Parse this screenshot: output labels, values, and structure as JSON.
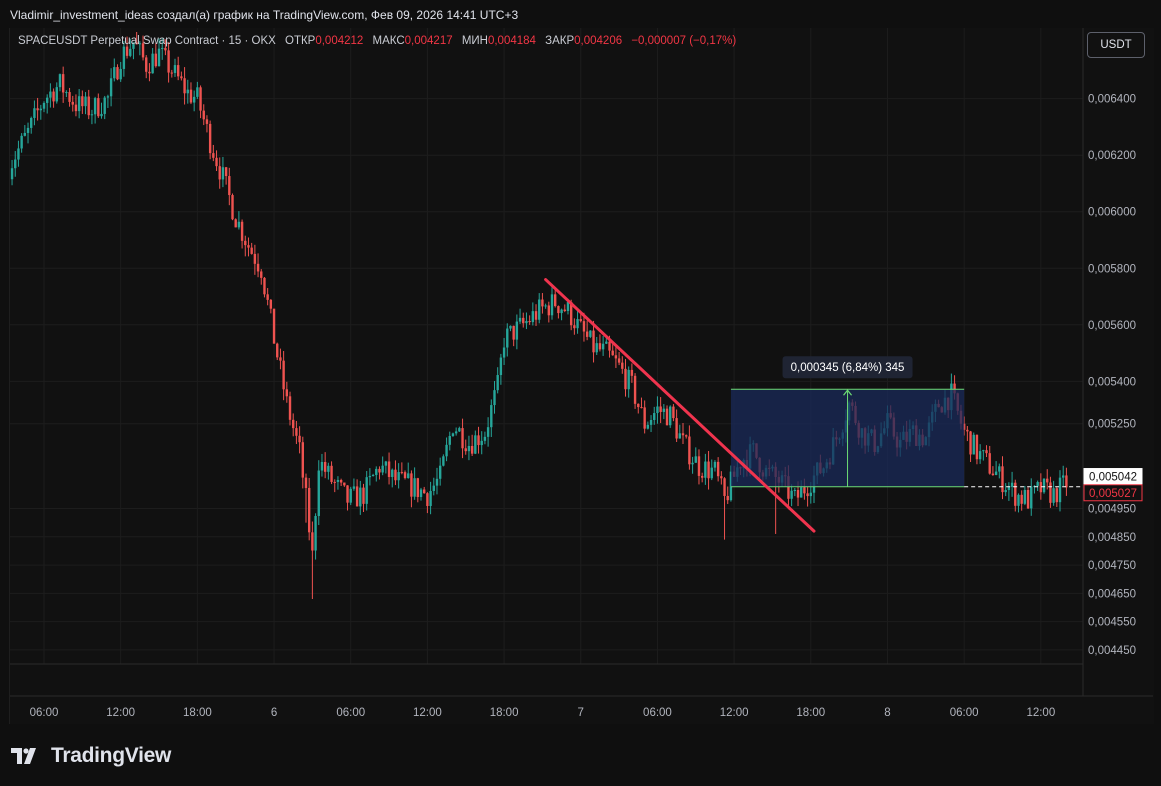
{
  "header": {
    "author_line": "Vladimir_investment_ideas создал(а) график на TradingView.com, Фев 09, 2026 14:41 UTC+3"
  },
  "legend": {
    "symbol": "SPACEUSDT Perpetual Swap Contract · 15 · OKX",
    "open_label": "ОТКР",
    "open_value": "0,004212",
    "high_label": "МАКС",
    "high_value": "0,004217",
    "low_label": "МИН",
    "low_value": "0,004184",
    "close_label": "ЗАКР",
    "close_value": "0,004206",
    "change": "−0,000007 (−0,17%)"
  },
  "currency_button": "USDT",
  "brand": {
    "name": "TradingView"
  },
  "colors": {
    "up": "#26a69a",
    "down": "#ef5350",
    "trendline": "#f0344e",
    "measure_fill": "#1a2a5a",
    "measure_line": "#6ddc74",
    "background": "#111111"
  },
  "chart_data": {
    "type": "candlestick",
    "ylim": [
      0.0044,
      0.00665
    ],
    "y_ticks": [
      "0,006400",
      "0,006200",
      "0,006000",
      "0,005800",
      "0,005600",
      "0,005400",
      "0,005250",
      "0,004950",
      "0,004850",
      "0,004750",
      "0,004650",
      "0,004550",
      "0,004450"
    ],
    "y_tick_values": [
      0.0064,
      0.0062,
      0.006,
      0.0058,
      0.0056,
      0.0054,
      0.00525,
      0.00495,
      0.00485,
      0.00475,
      0.00465,
      0.00455,
      0.00445
    ],
    "x_ticks": [
      "06:00",
      "12:00",
      "18:00",
      "6",
      "06:00",
      "12:00",
      "18:00",
      "7",
      "06:00",
      "12:00",
      "18:00",
      "8",
      "06:00",
      "12:00"
    ],
    "x_tick_index": [
      0,
      24,
      48,
      72,
      96,
      120,
      144,
      168,
      192,
      216,
      240,
      264,
      288,
      312
    ],
    "price_labels": [
      {
        "text": "0,005042",
        "value": 0.005042,
        "style": "white"
      },
      {
        "text": "0,005027",
        "value": 0.005027,
        "style": "red"
      }
    ],
    "dashed_level": 0.005027,
    "close_path": [
      [
        -11,
        0.00616
      ],
      [
        -5,
        0.00628
      ],
      [
        0,
        0.0064
      ],
      [
        5,
        0.00645
      ],
      [
        10,
        0.00638
      ],
      [
        15,
        0.00636
      ],
      [
        20,
        0.0064
      ],
      [
        24,
        0.00655
      ],
      [
        28,
        0.0066
      ],
      [
        32,
        0.00652
      ],
      [
        36,
        0.00656
      ],
      [
        40,
        0.0065
      ],
      [
        45,
        0.00642
      ],
      [
        48,
        0.0064
      ],
      [
        52,
        0.00625
      ],
      [
        56,
        0.00612
      ],
      [
        60,
        0.00598
      ],
      [
        64,
        0.00588
      ],
      [
        68,
        0.0058
      ],
      [
        72,
        0.00555
      ],
      [
        76,
        0.00532
      ],
      [
        80,
        0.00515
      ],
      [
        82,
        0.00498
      ],
      [
        84,
        0.00478
      ],
      [
        86,
        0.00512
      ],
      [
        90,
        0.00505
      ],
      [
        95,
        0.00498
      ],
      [
        100,
        0.005
      ],
      [
        105,
        0.0051
      ],
      [
        110,
        0.00505
      ],
      [
        115,
        0.00503
      ],
      [
        120,
        0.005
      ],
      [
        124,
        0.00506
      ],
      [
        128,
        0.00525
      ],
      [
        133,
        0.00518
      ],
      [
        138,
        0.00522
      ],
      [
        142,
        0.00538
      ],
      [
        144,
        0.00555
      ],
      [
        150,
        0.0056
      ],
      [
        155,
        0.00565
      ],
      [
        160,
        0.00568
      ],
      [
        164,
        0.00565
      ],
      [
        168,
        0.00558
      ],
      [
        172,
        0.00552
      ],
      [
        176,
        0.0055
      ],
      [
        180,
        0.00545
      ],
      [
        184,
        0.00538
      ],
      [
        188,
        0.00525
      ],
      [
        192,
        0.0053
      ],
      [
        196,
        0.00528
      ],
      [
        200,
        0.00518
      ],
      [
        205,
        0.0051
      ],
      [
        210,
        0.00508
      ],
      [
        213,
        0.00498
      ],
      [
        218,
        0.00512
      ],
      [
        222,
        0.00515
      ],
      [
        226,
        0.00508
      ],
      [
        230,
        0.00505
      ],
      [
        235,
        0.00498
      ],
      [
        240,
        0.00505
      ],
      [
        244,
        0.0051
      ],
      [
        248,
        0.0052
      ],
      [
        252,
        0.00532
      ],
      [
        256,
        0.00522
      ],
      [
        260,
        0.00518
      ],
      [
        264,
        0.00525
      ],
      [
        268,
        0.00518
      ],
      [
        272,
        0.00522
      ],
      [
        276,
        0.0052
      ],
      [
        280,
        0.00532
      ],
      [
        284,
        0.00535
      ],
      [
        288,
        0.00522
      ],
      [
        292,
        0.00515
      ],
      [
        296,
        0.0051
      ],
      [
        300,
        0.00505
      ],
      [
        304,
        0.005
      ],
      [
        308,
        0.00498
      ],
      [
        312,
        0.00502
      ],
      [
        316,
        0.005
      ],
      [
        320,
        0.00504
      ]
    ],
    "trendline": {
      "from": [
        157,
        0.00576
      ],
      "to": [
        241,
        0.00487
      ]
    },
    "measure": {
      "x_from": 215,
      "x_to": 288,
      "y_low": 0.005027,
      "y_high": 0.005372,
      "label": "0,000345 (6,84%) 345"
    }
  }
}
